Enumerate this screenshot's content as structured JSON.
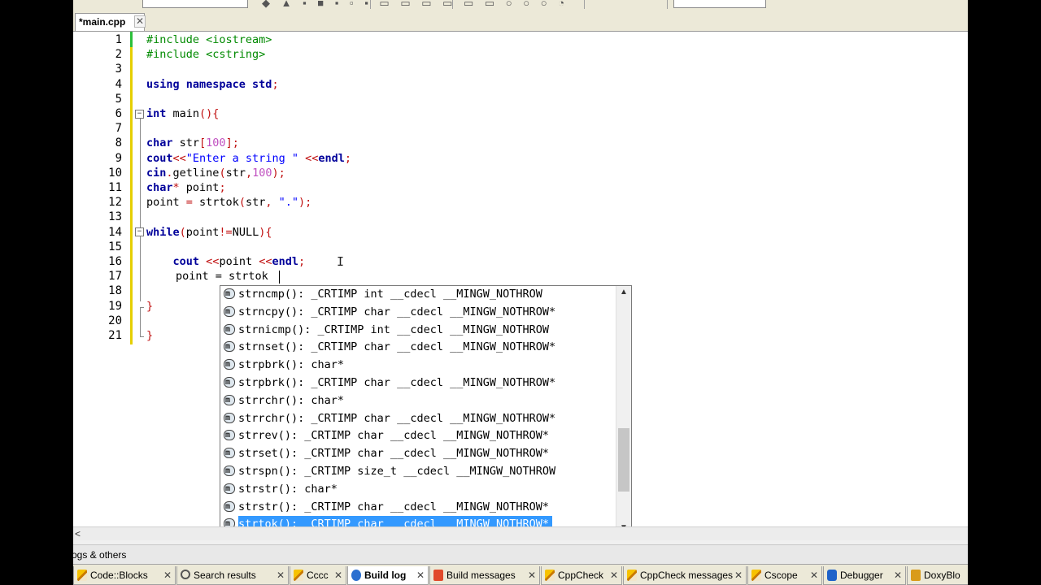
{
  "editor": {
    "tab_label": "*main.cpp",
    "tab_close": "✕",
    "line_numbers": [
      "1",
      "2",
      "3",
      "4",
      "5",
      "6",
      "7",
      "8",
      "9",
      "10",
      "11",
      "12",
      "13",
      "14",
      "15",
      "16",
      "17",
      "18",
      "19",
      "20",
      "21"
    ],
    "typed_text": "point = strtok"
  },
  "autocomplete": {
    "items": [
      "strncmp(): _CRTIMP int __cdecl __MINGW_NOTHROW",
      "strncpy(): _CRTIMP char __cdecl __MINGW_NOTHROW*",
      "strnicmp(): _CRTIMP int __cdecl __MINGW_NOTHROW",
      "strnset(): _CRTIMP char __cdecl __MINGW_NOTHROW*",
      "strpbrk(): char*",
      "strpbrk(): _CRTIMP char __cdecl __MINGW_NOTHROW*",
      "strrchr(): char*",
      "strrchr(): _CRTIMP char __cdecl __MINGW_NOTHROW*",
      "strrev(): _CRTIMP char __cdecl __MINGW_NOTHROW*",
      "strset(): _CRTIMP char __cdecl __MINGW_NOTHROW*",
      "strspn(): _CRTIMP size_t __cdecl __MINGW_NOTHROW",
      "strstr(): char*",
      "strstr(): _CRTIMP char __cdecl __MINGW_NOTHROW*",
      "strtok(): _CRTIMP char __cdecl __MINGW_NOTHROW*"
    ],
    "selected_index": 13,
    "scroll_up": "▲",
    "scroll_down": "▼"
  },
  "panel": {
    "title": "ogs & others"
  },
  "bottom_tabs": [
    {
      "label": "Code::Blocks",
      "icon": "pencil-icon",
      "close": "✕",
      "active": false
    },
    {
      "label": "Search results",
      "icon": "search-icon",
      "close": "✕",
      "active": false
    },
    {
      "label": "Cccc",
      "icon": "pencil-icon",
      "close": "✕",
      "active": false
    },
    {
      "label": "Build log",
      "icon": "gear-icon",
      "close": "✕",
      "active": true
    },
    {
      "label": "Build messages",
      "icon": "error-icon",
      "close": "✕",
      "active": false
    },
    {
      "label": "CppCheck",
      "icon": "pencil-icon",
      "close": "✕",
      "active": false
    },
    {
      "label": "CppCheck messages",
      "icon": "pencil-icon",
      "close": "✕",
      "active": false
    },
    {
      "label": "Cscope",
      "icon": "pencil-icon",
      "close": "✕",
      "active": false
    },
    {
      "label": "Debugger",
      "icon": "bug-icon",
      "close": "✕",
      "active": false
    },
    {
      "label": "DoxyBlo",
      "icon": "doxy-icon",
      "close": "",
      "active": false
    }
  ],
  "hscroll_left": "<"
}
